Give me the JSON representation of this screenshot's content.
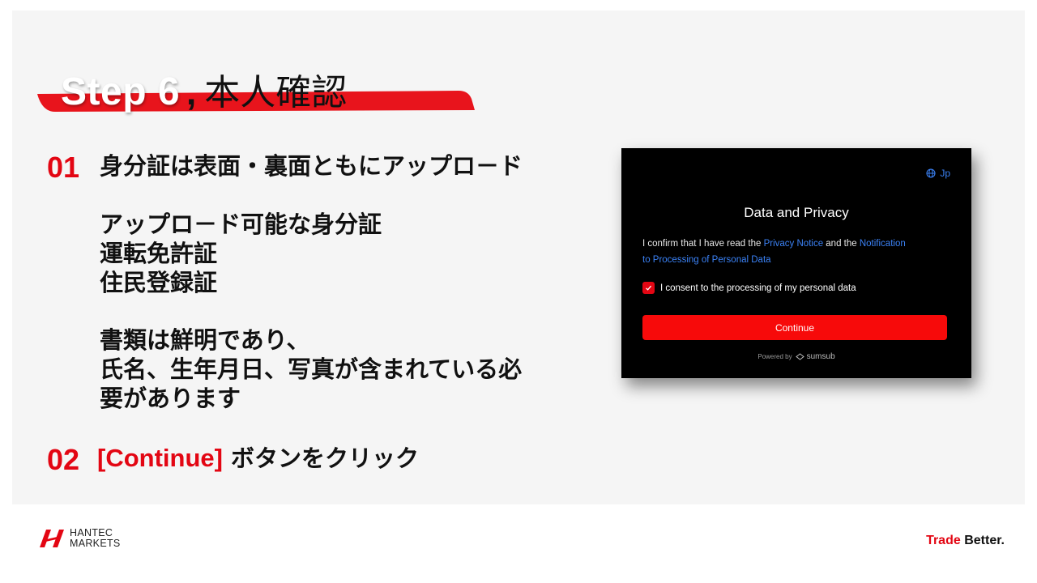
{
  "title": {
    "step": "Step 6",
    "comma": ",",
    "subject": "本人確認"
  },
  "step1": {
    "number": "01",
    "heading": "身分証は表面・裏面ともにアップロ－ド",
    "uploadable_heading": "アップロ－ド可能な身分証",
    "id_types": [
      "運転免許証",
      "住民登録証"
    ],
    "requirement_lines": [
      "書類は鮮明であり、",
      "氏名、生年月日、写真が含まれている必",
      "要があります"
    ]
  },
  "step2": {
    "number": "02",
    "button_ref": "[Continue]",
    "text": "ボタンをクリック"
  },
  "dialog": {
    "language": "Jp",
    "title": "Data and Privacy",
    "confirm_prefix": "I confirm that I have read the ",
    "privacy_link": "Privacy Notice",
    "confirm_middle": " and the ",
    "notification_link_1": "Notification",
    "notification_link_2": "to Processing of Personal Data",
    "consent_label": "I consent to the processing of my personal data",
    "consent_checked": true,
    "continue_label": "Continue",
    "powered_by": "Powered by",
    "provider": "sumsub"
  },
  "footer": {
    "logo_line1": "HANTEC",
    "logo_line2": "MARKETS",
    "tagline_red": "Trade",
    "tagline_dark": "Better."
  },
  "colors": {
    "brand_red": "#e30613",
    "link_blue": "#3b82f6",
    "dialog_bg": "#000000",
    "slide_bg": "#f5f5f5"
  }
}
